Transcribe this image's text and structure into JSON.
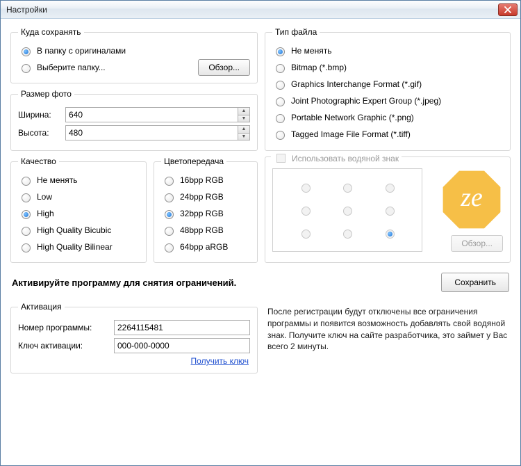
{
  "window": {
    "title": "Настройки"
  },
  "save": {
    "legend": "Куда сохранять",
    "opt_original": "В папку с оригиналами",
    "opt_choose": "Выберите папку...",
    "browse": "Обзор...",
    "selected": "original"
  },
  "filetype": {
    "legend": "Тип файла",
    "options": [
      "Не менять",
      "Bitmap (*.bmp)",
      "Graphics Interchange Format (*.gif)",
      "Joint Photographic Expert Group (*.jpeg)",
      "Portable Network Graphic (*.png)",
      "Tagged Image File Format (*.tiff)"
    ],
    "selected_index": 0
  },
  "size": {
    "legend": "Размер фото",
    "width_label": "Ширина:",
    "height_label": "Высота:",
    "width": "640",
    "height": "480"
  },
  "quality": {
    "legend": "Качество",
    "options": [
      "Не менять",
      "Low",
      "High",
      "High Quality Bicubic",
      "High Quality Bilinear"
    ],
    "selected_index": 2
  },
  "color": {
    "legend": "Цветопередача",
    "options": [
      "16bpp RGB",
      "24bpp RGB",
      "32bpp RGB",
      "48bpp RGB",
      "64bpp aRGB"
    ],
    "selected_index": 2
  },
  "watermark": {
    "use_label": "Использовать водяной знак",
    "enabled": false,
    "browse": "Обзор...",
    "position_selected": 8
  },
  "activate_banner": "Активируйте программу для снятия ограничений.",
  "save_button": "Сохранить",
  "activation": {
    "legend": "Активация",
    "program_number_label": "Номер программы:",
    "program_number": "2264115481",
    "key_label": "Ключ активации:",
    "key": "000-000-0000",
    "get_key": "Получить ключ"
  },
  "reg_text": "После регистрации будут отключены все ограничения программы и появится возможность добавлять свой водяной знак. Получите ключ на сайте разработчика, это займет у Вас всего 2 минуты."
}
